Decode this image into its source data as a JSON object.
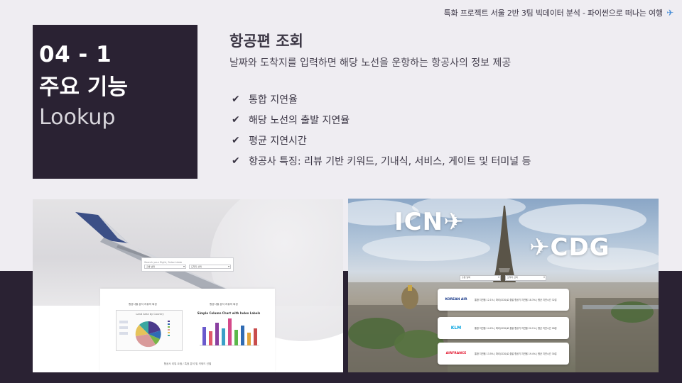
{
  "header": {
    "caption": "특화 프로젝트 서울 2반 3팀 빅데이터 분석 - 파이썬으로 떠나는 여행",
    "icon": "airplane-icon"
  },
  "section": {
    "number": "04 - 1",
    "title": "주요 기능",
    "subtitle": "Lookup"
  },
  "feature": {
    "title": "항공편 조회",
    "description": "날짜와 도착지를 입력하면 해당 노선을 운항하는 항공사의 정보 제공",
    "items": [
      "통합 지연율",
      "해당 노선의 출발 지연율",
      "평균 지연시간",
      "항공사 특징: 리뷰 기반 키워드, 기내식, 서비스, 게이트 및 터미널 등"
    ]
  },
  "screenshot_left": {
    "search_hint": "Search your flight, Select date",
    "select_date": "출발 날짜",
    "select_dest": "도착지 선택",
    "caption_left": "항공사별 분석 리뷰의 특징",
    "caption_right": "항공사별 분석 리뷰의 특징",
    "pie_title": "Land Area by Country",
    "bar_title": "Simple Column Chart with Index Labels",
    "footer": "항공사 리뷰 요점 / 특정 분석 및 키워드 선별"
  },
  "screenshot_right": {
    "route_from": "ICN",
    "route_to": "CDG",
    "select_date": "출발 날짜",
    "select_dest": "도착지 선택",
    "airlines": [
      {
        "name": "KOREAN AIR",
        "info": "통합 지연율 12.1% | 파리(CDG)로 출발 항공기 지연율 18.3% | 평균 지연시간 32분"
      },
      {
        "name": "KLM",
        "info": "통합 지연율 14.2% | 파리(CDG)로 출발 항공기 지연율 20.1% | 평균 지연시간 28분"
      },
      {
        "name": "AIRFRANCE",
        "info": "통합 지연율 13.5% | 파리(CDG)로 출발 항공기 지연율 19.4% | 평균 지연시간 30분"
      }
    ]
  },
  "colors": {
    "dark": "#2a2233",
    "background": "#efedf2",
    "korean_air": "#1b3b8a",
    "klm": "#00a1de",
    "airfrance": "#e2132b"
  }
}
